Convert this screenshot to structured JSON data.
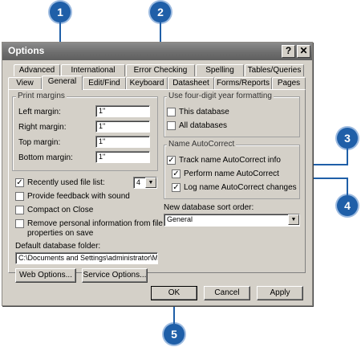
{
  "window": {
    "title": "Options",
    "help_glyph": "?",
    "close_glyph": "✕"
  },
  "tabs_row1": [
    {
      "label": "Advanced"
    },
    {
      "label": "International"
    },
    {
      "label": "Error Checking"
    },
    {
      "label": "Spelling"
    },
    {
      "label": "Tables/Queries"
    }
  ],
  "tabs_row2": [
    {
      "label": "View"
    },
    {
      "label": "General",
      "active": true
    },
    {
      "label": "Edit/Find"
    },
    {
      "label": "Keyboard"
    },
    {
      "label": "Datasheet"
    },
    {
      "label": "Forms/Reports"
    },
    {
      "label": "Pages"
    }
  ],
  "print_margins": {
    "title": "Print margins",
    "rows": [
      {
        "label": "Left margin:",
        "value": "1\""
      },
      {
        "label": "Right margin:",
        "value": "1\""
      },
      {
        "label": "Top margin:",
        "value": "1\""
      },
      {
        "label": "Bottom margin:",
        "value": "1\""
      }
    ]
  },
  "recent_files": {
    "label": "Recently used file list:",
    "checked": true,
    "value": "4"
  },
  "left_checks": [
    {
      "label": "Provide feedback with sound",
      "checked": false
    },
    {
      "label": "Compact on Close",
      "checked": false
    },
    {
      "label": "Remove personal information from file",
      "label2": "properties on save",
      "checked": false
    }
  ],
  "default_folder": {
    "label": "Default database folder:",
    "value": "C:\\Documents and Settings\\administrator\\My"
  },
  "web_options_label": "Web Options...",
  "service_options_label": "Service Options...",
  "four_digit": {
    "title": "Use four-digit year formatting",
    "items": [
      {
        "label": "This database",
        "checked": false
      },
      {
        "label": "All databases",
        "checked": false
      }
    ]
  },
  "autocorrect": {
    "title": "Name AutoCorrect",
    "items": [
      {
        "label": "Track name AutoCorrect info",
        "checked": true
      },
      {
        "label": "Perform name AutoCorrect",
        "checked": true
      },
      {
        "label": "Log name AutoCorrect changes",
        "checked": true
      }
    ]
  },
  "sort_order": {
    "label": "New database sort order:",
    "value": "General"
  },
  "buttons": {
    "ok": "OK",
    "cancel": "Cancel",
    "apply": "Apply"
  },
  "check_glyph": "✓",
  "arrow_glyph": "▼",
  "callouts": [
    "1",
    "2",
    "3",
    "4",
    "5"
  ],
  "colors": {
    "callout": "#1f5fa8",
    "dialog": "#d4d0c8",
    "titlebar": "#6e6e6e"
  }
}
